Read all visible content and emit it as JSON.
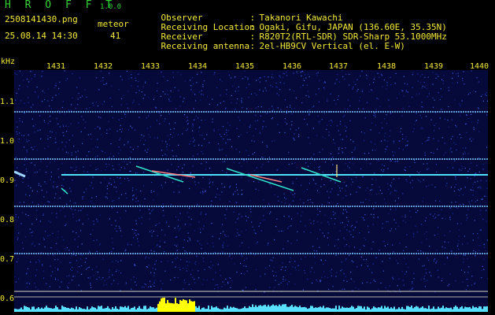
{
  "header": {
    "app_title": "H R O F F T",
    "app_version": "1.0.0",
    "filename": "2508141430.png",
    "datetime": "25.08.14 14:30",
    "meteor_label": "meteor",
    "meteor_count": "41"
  },
  "station": {
    "rows": [
      {
        "key": "Observer",
        "sep": ":",
        "value": "Takanori Kawachi"
      },
      {
        "key": "Receiving Location",
        "sep": ":",
        "value": "Ogaki, Gifu, JAPAN (136.60E, 35.35N)"
      },
      {
        "key": "Receiver",
        "sep": ":",
        "value": "R820T2(RTL-SDR) SDR-Sharp 53.1000MHz"
      },
      {
        "key": "Receiving antenna",
        "sep": ":",
        "value": "2el-HB9CV Vertical (el. E-W)"
      }
    ]
  },
  "axes": {
    "unit": "kHz",
    "time_ticks": [
      "1431",
      "1432",
      "1433",
      "1434",
      "1435",
      "1436",
      "1437",
      "1438",
      "1439",
      "1440"
    ],
    "freq_ticks": [
      "1.1",
      "1.0",
      "0.9",
      "0.8",
      "0.7",
      "0.6"
    ]
  },
  "colors": {
    "header_green": "#34d234",
    "text_yellow": "#f2e83a",
    "background": "#000000",
    "noise_blue": "#1f2ea6",
    "carrier": "#5ab0ff",
    "meteor_trail": "#30e0c8",
    "histogram": "#ffff00"
  }
}
